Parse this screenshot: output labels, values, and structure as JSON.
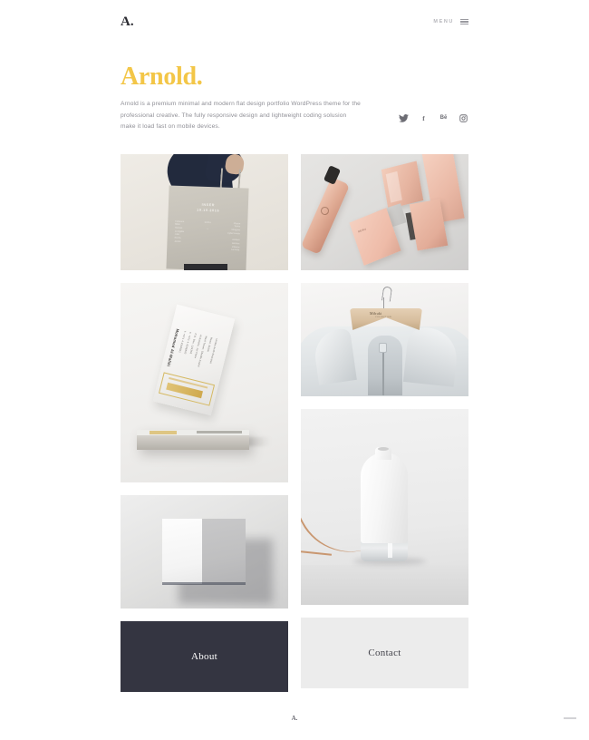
{
  "header": {
    "logo": "A.",
    "menu_label": "MENU",
    "menu_icon": "hamburger-icon"
  },
  "intro": {
    "title": "Arnold.",
    "description": "Arnold is a premium minimal and modern flat design portfolio WordPress theme for the professional creative. The fully responsive design and lightweight coding solusion make it load fast on mobile devices.",
    "accent_color": "#f3c647",
    "social": [
      {
        "name": "twitter",
        "glyph": ""
      },
      {
        "name": "facebook",
        "glyph": "f"
      },
      {
        "name": "behance",
        "glyph": "Bē"
      },
      {
        "name": "instagram",
        "glyph": ""
      }
    ]
  },
  "portfolio": {
    "tiles": [
      {
        "id": "tote-bag",
        "label": "Tote bag product photograph"
      },
      {
        "id": "cosmetics",
        "label": "Rose gold cosmetics packaging"
      },
      {
        "id": "business-card",
        "label": "Gold foil business card on stack"
      },
      {
        "id": "hanger-garment",
        "label": "Wooden hanger with silver garment"
      },
      {
        "id": "folded-book",
        "label": "Open white and grey brochure"
      },
      {
        "id": "white-bottle",
        "label": "White ceramic bottle with glass base"
      }
    ],
    "tote_print": {
      "title": "INSER",
      "date": "19.10.2016",
      "col_left": "Fabienne\nMiller\nHumain\nCorrigible\nLuke\nRocha\nJanine",
      "col_mid": "SOFIA\n\n+",
      "col_right": "Clause\nTarres\nMorgane\nCybel Lavois\n\nAndrem\nBontroc\nEtienne\nLecomte",
      "footer": "Presentation"
    },
    "business_card": {
      "name": "Mohamed Al-Maliki",
      "lines": [
        "T. +971 4 3348801",
        "F. +971 4 3348802",
        "P.O. Box, 124356",
        "Al Barsha, 1st Floor",
        "Wasl Tower, Sheikh Zayed",
        "Road, Dubai",
        "United Arab Emirates"
      ],
      "foil_brand": "AL MALIKI",
      "foil_sub": "contracting & general maintenance"
    },
    "hanger": {
      "brand": "Mibuki",
      "sub": "COLLECTION"
    },
    "cosmetics": {
      "box_label": "BEIRU"
    }
  },
  "panels": [
    {
      "name": "about",
      "label": "About",
      "background": "#343541",
      "text_color": "#ffffff"
    },
    {
      "name": "contact",
      "label": "Contact",
      "background": "#ececec",
      "text_color": "#43434b"
    }
  ],
  "footer": {
    "logo": "A.",
    "scroll_indicator": "scroll-indicator"
  }
}
